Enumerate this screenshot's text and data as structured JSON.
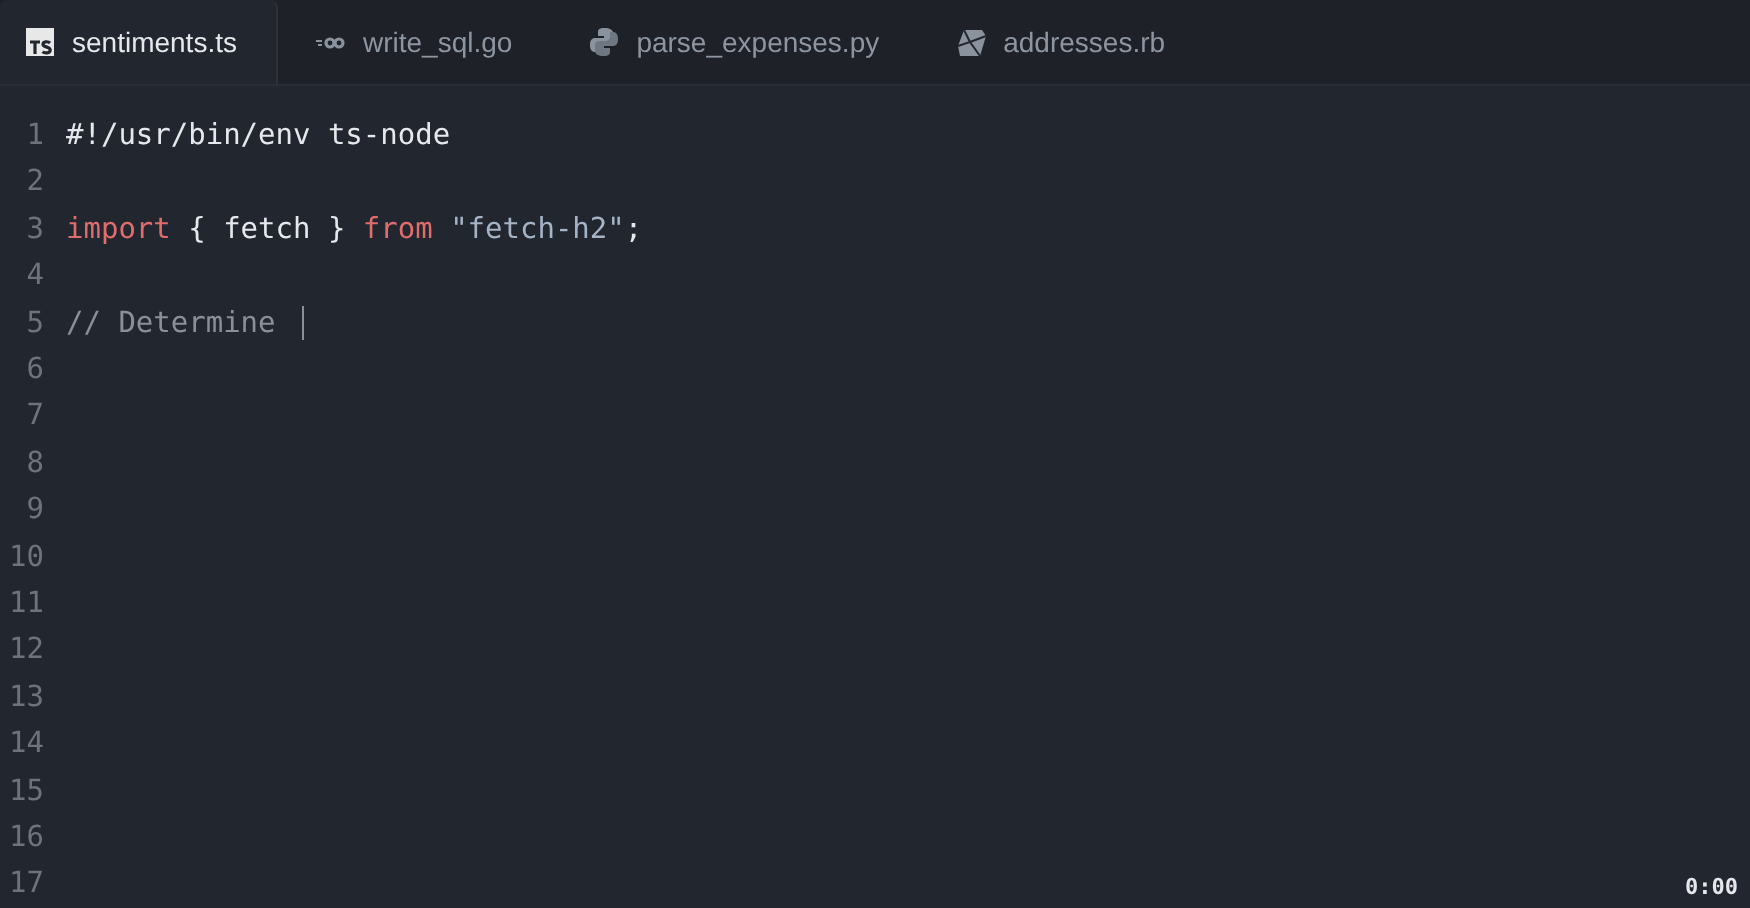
{
  "tabs": [
    {
      "label": "sentiments.ts",
      "kind": "ts",
      "selected": true
    },
    {
      "label": "write_sql.go",
      "kind": "go",
      "selected": false
    },
    {
      "label": "parse_expenses.py",
      "kind": "py",
      "selected": false
    },
    {
      "label": "addresses.rb",
      "kind": "rb",
      "selected": false
    }
  ],
  "editor": {
    "lines": [
      {
        "number": "1",
        "tokens": [
          {
            "kind": "plain",
            "text": "#!/usr/bin/env ts-node"
          }
        ]
      },
      {
        "number": "2"
      },
      {
        "number": "3",
        "tokens": [
          {
            "kind": "keyword",
            "text": "import"
          },
          {
            "kind": "plain",
            "text": " { fetch } "
          },
          {
            "kind": "keyword",
            "text": "from "
          },
          {
            "kind": "string",
            "text": "\"fetch-h2\""
          },
          {
            "kind": "plain",
            "text": ";"
          }
        ]
      },
      {
        "number": "4"
      },
      {
        "number": "5",
        "tokens": [
          {
            "kind": "comment",
            "text": "// Determine"
          }
        ],
        "cursor": true
      },
      {
        "number": "6"
      },
      {
        "number": "7"
      },
      {
        "number": "8"
      },
      {
        "number": "9"
      },
      {
        "number": "10"
      },
      {
        "number": "11"
      },
      {
        "number": "12"
      },
      {
        "number": "13"
      },
      {
        "number": "14"
      },
      {
        "number": "15"
      },
      {
        "number": "16"
      },
      {
        "number": "17"
      }
    ]
  },
  "timer": "0:00"
}
